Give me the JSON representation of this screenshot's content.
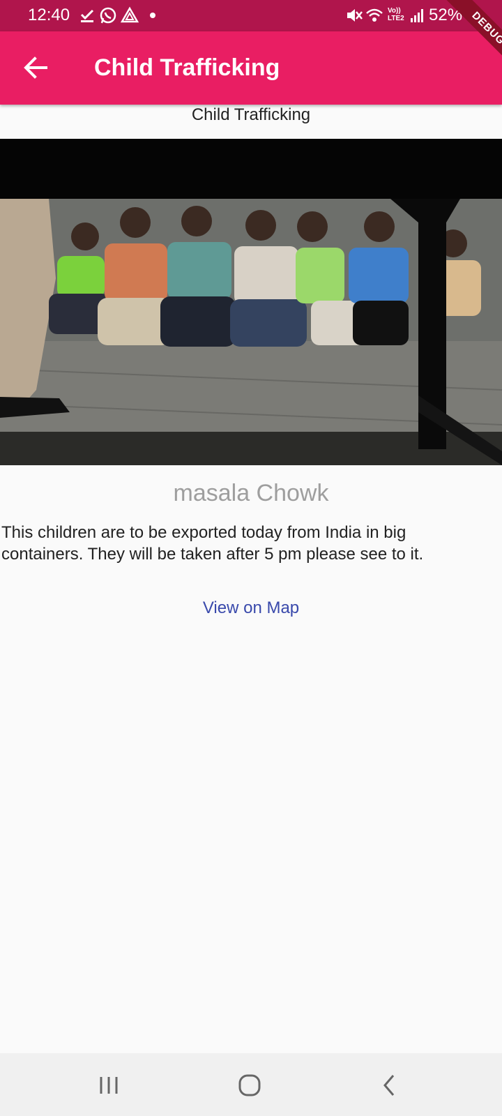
{
  "status_bar": {
    "time": "12:40",
    "icons": [
      "download-done-icon",
      "whatsapp-icon",
      "drive-icon",
      "notification-dot-icon",
      "mute-icon",
      "wifi-icon",
      "lte-signal-icon"
    ],
    "lte_label_top": "Vo))",
    "lte_label_bottom": "LTE2",
    "battery": "52%"
  },
  "debug_banner": "DEBUG",
  "app_bar": {
    "title": "Child Trafficking",
    "back_icon": "arrow-left-icon"
  },
  "content": {
    "subtitle": "Child Trafficking",
    "image_description": "Children sitting on the floor against a wall",
    "location": "masala Chowk",
    "description": "This children are to be exported today from India in big containers. They will be taken after 5 pm please see to it.",
    "map_button_label": "View on Map"
  },
  "nav_bar": {
    "icons": [
      "recent-apps-icon",
      "home-icon",
      "back-icon"
    ]
  },
  "colors": {
    "status_bar": "#b0154c",
    "app_bar": "#e91e63",
    "link": "#3949ab",
    "location_text": "#9e9e9e",
    "background": "#fafafa"
  }
}
